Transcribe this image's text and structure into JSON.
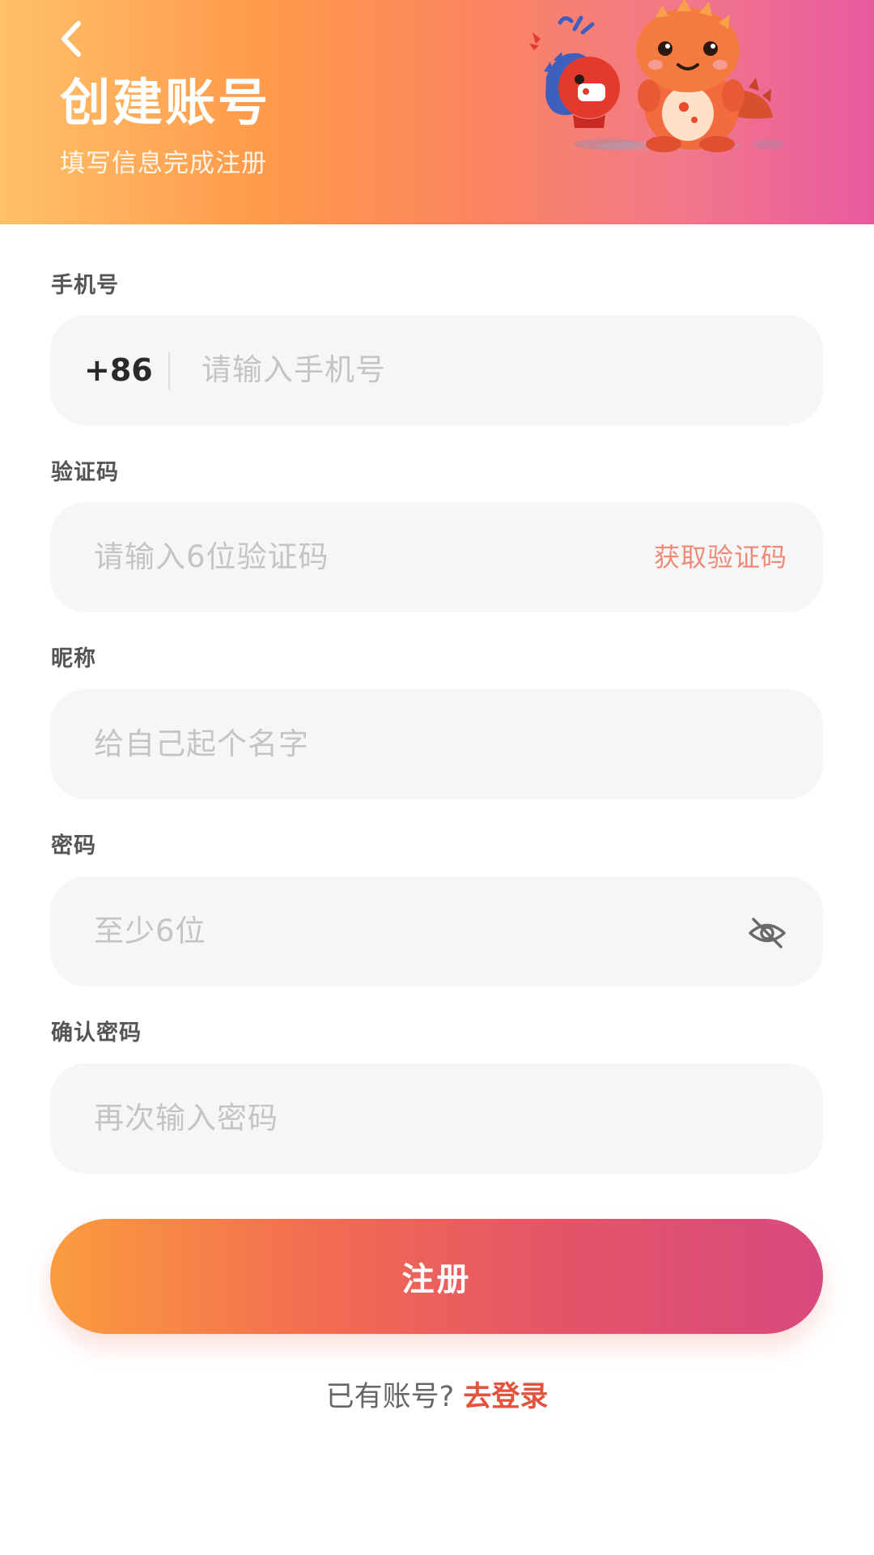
{
  "header": {
    "title": "创建账号",
    "subtitle": "填写信息完成注册",
    "back_icon": "chevron-left-icon",
    "mascot": "dinosaur-mascot-illustration"
  },
  "form": {
    "phone": {
      "label": "手机号",
      "prefix": "+86",
      "placeholder": "请输入手机号",
      "value": ""
    },
    "code": {
      "label": "验证码",
      "placeholder": "请输入6位验证码",
      "value": "",
      "action_label": "获取验证码"
    },
    "nickname": {
      "label": "昵称",
      "placeholder": "给自己起个名字",
      "value": ""
    },
    "password": {
      "label": "密码",
      "placeholder": "至少6位",
      "value": "",
      "toggle_icon": "eye-off-icon"
    },
    "confirm": {
      "label": "确认密码",
      "placeholder": "再次输入密码",
      "value": ""
    }
  },
  "submit_label": "注册",
  "footer": {
    "prompt": "已有账号?",
    "link": "去登录"
  },
  "colors": {
    "accent": "#e4523e",
    "code_button": "#ee8a78",
    "button_gradient_start": "#fb9c3e",
    "button_gradient_end": "#d84a7e",
    "header_gradient_start": "#ffc06a",
    "header_gradient_end": "#e85aa0"
  }
}
